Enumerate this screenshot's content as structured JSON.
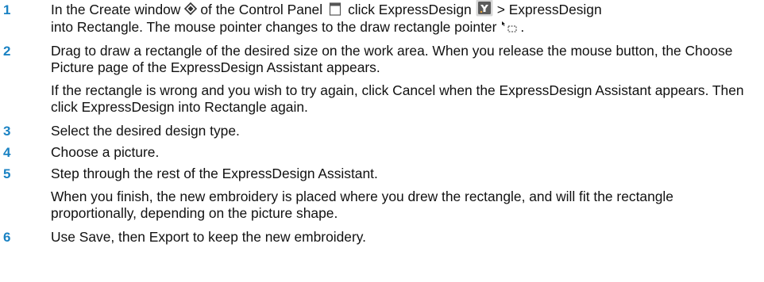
{
  "colors": {
    "step_number": "#1a82c3",
    "text": "#111111",
    "icon_dark": "#333333"
  },
  "icons": {
    "create": "create-window-icon",
    "control_panel": "control-panel-icon",
    "express_design": "expressdesign-icon",
    "draw_rectangle": "draw-rectangle-pointer-icon"
  },
  "steps": [
    {
      "number": "1",
      "seg_a": "In the Create window",
      "seg_b": "of the Control Panel",
      "seg_c": "click ExpressDesign",
      "seg_d": "> ExpressDesign",
      "seg_e": "into Rectangle. The mouse pointer changes to the draw rectangle pointer",
      "seg_f": "."
    },
    {
      "number": "2",
      "text": "Drag to draw a rectangle of the desired size on the work area. When you release the mouse button, the Choose Picture page of the ExpressDesign Assistant appears.",
      "note": "If the rectangle is wrong and you wish to try again, click Cancel when the ExpressDesign Assistant appears. Then click ExpressDesign into Rectangle again."
    },
    {
      "number": "3",
      "text": "Select the desired design type."
    },
    {
      "number": "4",
      "text": "Choose a picture."
    },
    {
      "number": "5",
      "text": "Step through the rest of the ExpressDesign Assistant.",
      "note": "When you finish, the new embroidery is placed where you drew the rectangle, and will fit the rectangle proportionally, depending on the picture shape."
    },
    {
      "number": "6",
      "text": "Use Save, then Export to keep the new embroidery."
    }
  ]
}
